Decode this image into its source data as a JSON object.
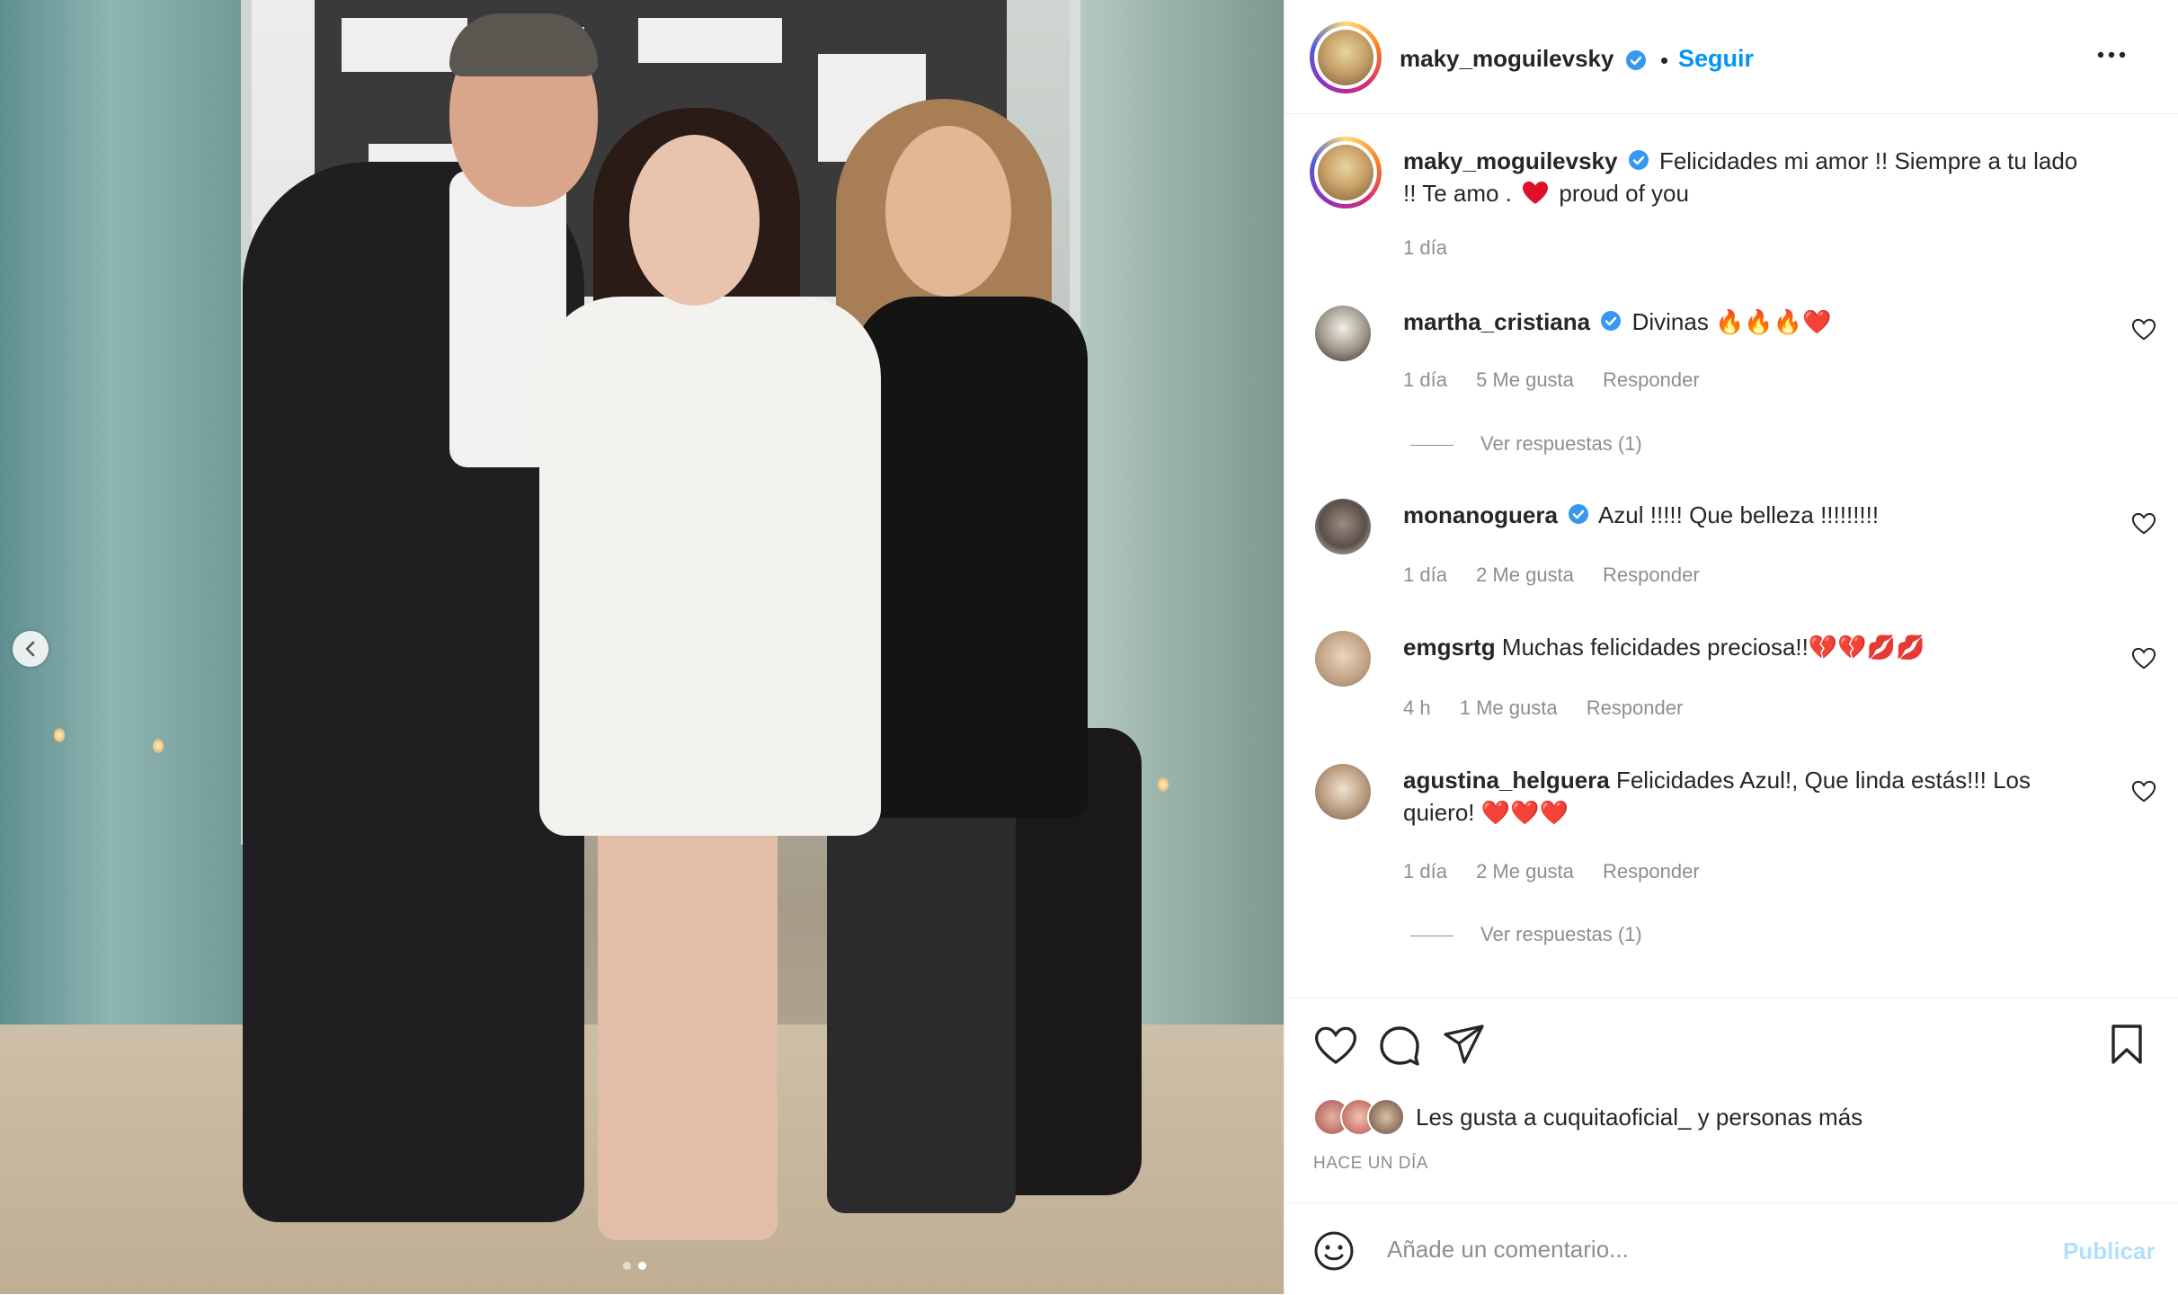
{
  "post_author": {
    "username": "maky_moguilevsky",
    "separator": "•",
    "follow_label": "Seguir",
    "more_icon": "more-horizontal-icon"
  },
  "caption": {
    "username": "maky_moguilevsky",
    "text_line1": "Felicidades mi amor !! Siempre a tu lado",
    "text_line2_a": "!! Te amo .",
    "text_line2_b": "proud of you",
    "time": "1 día"
  },
  "comments": [
    {
      "username": "martha_cristiana",
      "verified": true,
      "text": "Divinas",
      "emoji": "🔥🔥🔥❤️",
      "time": "1 día",
      "likes": "5 Me gusta",
      "reply": "Responder",
      "view_replies": "Ver respuestas (1)"
    },
    {
      "username": "monanoguera",
      "verified": true,
      "text": "Azul !!!!! Que belleza !!!!!!!!!",
      "time": "1 día",
      "likes": "2 Me gusta",
      "reply": "Responder"
    },
    {
      "username": "emgsrtg",
      "verified": false,
      "text": "Muchas felicidades preciosa!!",
      "emoji": "💔💔💋💋",
      "time": "4 h",
      "likes": "1 Me gusta",
      "reply": "Responder"
    },
    {
      "username": "agustina_helguera",
      "verified": false,
      "text_line1": "Felicidades Azul!, Que linda estás!!! Los",
      "text_line2": "quiero!",
      "emoji": "❤️❤️❤️",
      "time": "1 día",
      "likes": "2 Me gusta",
      "reply": "Responder",
      "view_replies": "Ver respuestas (1)"
    }
  ],
  "likes_summary": "Les gusta a cuquitaoficial_ y personas más",
  "time_ago": "HACE UN DÍA",
  "composer": {
    "placeholder": "Añade un comentario...",
    "publish_label": "Publicar"
  },
  "carousel": {
    "count": 2,
    "active_index": 1
  },
  "colors": {
    "link_blue": "#0095f6",
    "heart_red": "#ed4956",
    "publish_disabled": "#b2dffc",
    "meta_gray": "#8e8e8e"
  }
}
